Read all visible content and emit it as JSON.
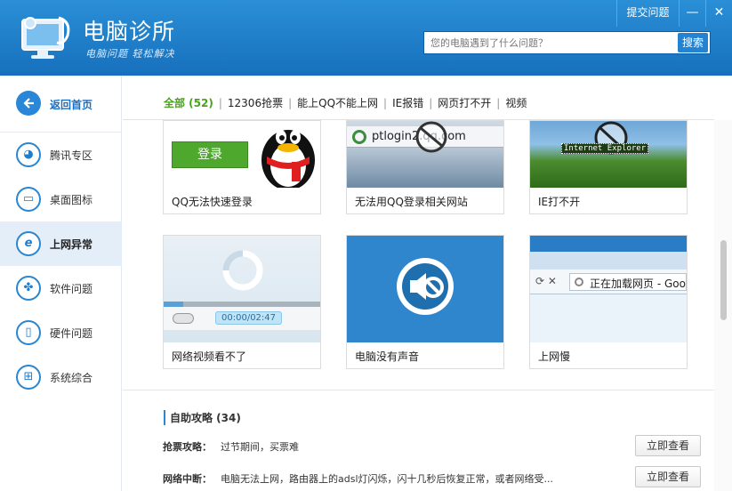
{
  "header": {
    "title": "电脑诊所",
    "slogan": "电脑问题 轻松解决",
    "feedback_label": "提交问题",
    "minimize_label": "—",
    "close_label": "✕",
    "search": {
      "placeholder": "您的电脑遇到了什么问题？",
      "button_label": "搜索"
    }
  },
  "sidebar": {
    "back_label": "返回首页",
    "items": [
      {
        "label": "腾讯专区",
        "icon": "penguin-icon"
      },
      {
        "label": "桌面图标",
        "icon": "monitor-icon"
      },
      {
        "label": "上网异常",
        "icon": "ie-icon",
        "active": true
      },
      {
        "label": "软件问题",
        "icon": "software-icon"
      },
      {
        "label": "硬件问题",
        "icon": "phone-icon"
      },
      {
        "label": "系统综合",
        "icon": "windows-icon"
      }
    ]
  },
  "tabs": [
    "全部 (52)",
    "12306抢票",
    "能上QQ不能上网",
    "IE报错",
    "网页打不开",
    "视频"
  ],
  "cards": [
    {
      "caption": "QQ无法快速登录",
      "login_label": "登录"
    },
    {
      "caption": "无法用QQ登录相关网站",
      "url_text": "ptlogin2.qq.com"
    },
    {
      "caption": "IE打不开",
      "ie_text": "Internet Explorer"
    },
    {
      "caption": "网络视频看不了",
      "time_text": "00:00/02:47"
    },
    {
      "caption": "电脑没有声音"
    },
    {
      "caption": "上网慢",
      "loading_text": "正在加载网页 - Goo"
    }
  ],
  "guide": {
    "heading": "自助攻略 (34)",
    "rows": [
      {
        "label": "抢票攻略：",
        "text": "过节期间，买票难",
        "button": "立即查看"
      },
      {
        "label": "网络中断：",
        "text": "电脑无法上网，路由器上的adsl灯闪烁，闪十几秒后恢复正常，或者网络受...",
        "button": "立即查看"
      }
    ]
  },
  "colors": {
    "header_blue": "#1f80cc",
    "active_green": "#49a11c",
    "accent_blue": "#2a86d6"
  }
}
